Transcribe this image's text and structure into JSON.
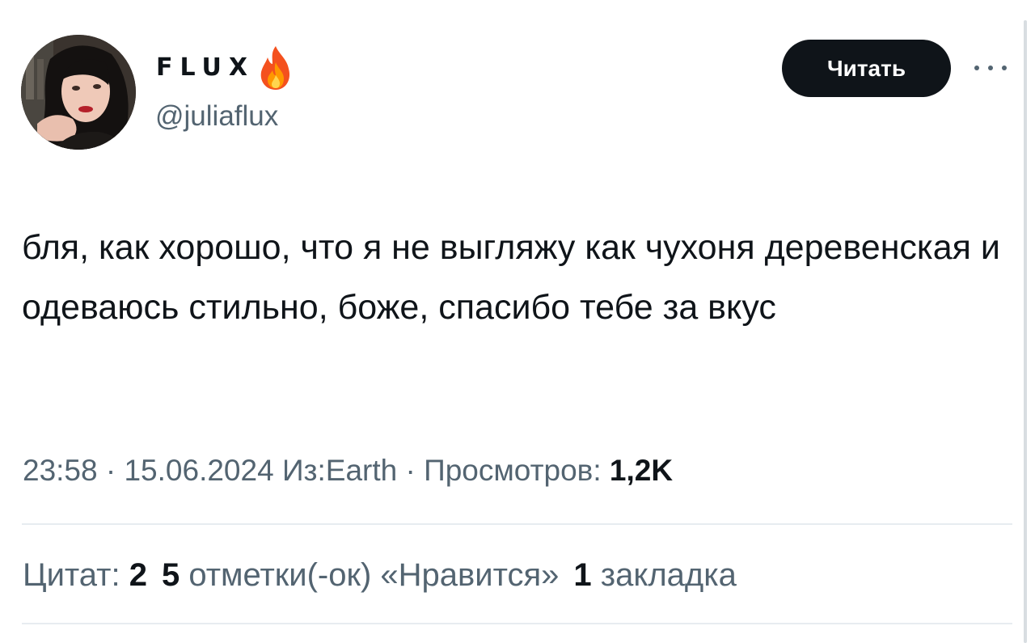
{
  "author": {
    "display_name": "FLUX",
    "handle": "@juliaflux",
    "name_emoji_icon": "fire-icon"
  },
  "actions": {
    "follow_label": "Читать",
    "more_icon": "more-horizontal-icon"
  },
  "tweet": {
    "text": "бля, как хорошо, что я не выгляжу как чухоня деревенская и одеваюсь стильно, боже, спасибо тебе за вкус"
  },
  "meta": {
    "time": "23:58",
    "separator": " · ",
    "date": "15.06.2024",
    "source": "Из:Earth",
    "views_label": "Просмотров: ",
    "views_count": "1,2K"
  },
  "stats": {
    "quotes_label": "Цитат: ",
    "quotes_count": "2",
    "likes_count": "5",
    "likes_label": " отметки(-ок) «Нравится»",
    "bookmarks_count": "1",
    "bookmarks_label": " закладка"
  },
  "colors": {
    "primary_text": "#0f1419",
    "secondary_text": "#536471",
    "button_bg": "#0f1419",
    "divider": "#e7ecf0"
  }
}
